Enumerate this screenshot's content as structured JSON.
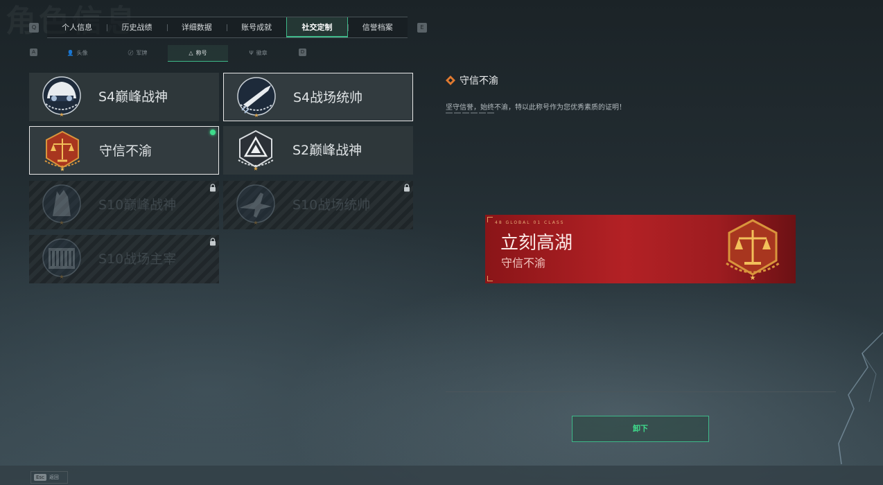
{
  "window": {
    "bg_title": "角色信息"
  },
  "key_hints": {
    "prev_tab": "Q",
    "next_tab": "E",
    "prev_subtab": "A",
    "next_subtab": "D"
  },
  "tabs": [
    {
      "label": "个人信息",
      "active": false
    },
    {
      "label": "历史战绩",
      "active": false
    },
    {
      "label": "详细数据",
      "active": false
    },
    {
      "label": "账号成就",
      "active": false
    },
    {
      "label": "社交定制",
      "active": true
    },
    {
      "label": "信誉档案",
      "active": false
    }
  ],
  "subtabs": [
    {
      "label": "头像",
      "icon": "person-icon",
      "glyph": "👤",
      "active": false
    },
    {
      "label": "军牌",
      "icon": "dogtag-icon",
      "glyph": "〄",
      "active": false
    },
    {
      "label": "称号",
      "icon": "triangle-icon",
      "glyph": "△",
      "active": true
    },
    {
      "label": "徽章",
      "icon": "emblem-icon",
      "glyph": "Ψ",
      "active": false
    }
  ],
  "titles": [
    {
      "name": "S4巅峰战神",
      "badge": "helmet-badge",
      "state": "unlocked"
    },
    {
      "name": "S4战场统帅",
      "badge": "rocket-badge",
      "state": "selected"
    },
    {
      "name": "守信不渝",
      "badge": "scales-badge",
      "state": "equipped"
    },
    {
      "name": "S2巅峰战神",
      "badge": "triangle-badge",
      "state": "unlocked"
    },
    {
      "name": "S10巅峰战神",
      "badge": "tower-badge",
      "state": "locked"
    },
    {
      "name": "S10战场统帅",
      "badge": "jet-badge",
      "state": "locked"
    },
    {
      "name": "S10战场主宰",
      "badge": "colosseum-badge",
      "state": "locked"
    }
  ],
  "detail": {
    "title": "守信不渝",
    "description": "坚守信誉，始终不渝，特以此称号作为您优秀素质的证明！"
  },
  "nameplate": {
    "player_name": "立刻高湖",
    "title": "守信不渝",
    "tiny_text": "48 GLOBAL 01 CLASS"
  },
  "actions": {
    "unequip_label": "卸下",
    "back_key": "Esc",
    "back_label": "返回"
  },
  "colors": {
    "accent": "#3fb98a",
    "equipped_dot": "#3fdc8c",
    "nameplate_red": "#b32125"
  }
}
